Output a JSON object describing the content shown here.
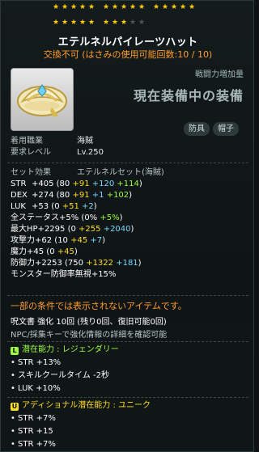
{
  "stars": {
    "total": 25,
    "filled": 23,
    "filled_color": "#ffcc00",
    "empty_color": "#555555"
  },
  "item": {
    "name": "エテルネルパイレーツハット",
    "trade_note": "交換不可 (はさみの使用可能回数:10 / 10)"
  },
  "compare": {
    "label": "戦闘力増加量",
    "current": "現在装備中の装備"
  },
  "badges": [
    "防具",
    "帽子"
  ],
  "info": [
    {
      "key": "着用職業",
      "value": "海賊"
    },
    {
      "key": "要求レベル",
      "value": "Lv.250"
    }
  ],
  "set_effect": {
    "label": "セット効果",
    "name": "エテルネルセット(海賊)"
  },
  "stats": [
    {
      "label": "STR",
      "total": "+405",
      "parts": [
        {
          "t": "(80 ",
          "c": "white"
        },
        {
          "t": "+91 ",
          "c": "yellow"
        },
        {
          "t": "+120 ",
          "c": "blue"
        },
        {
          "t": "+114",
          "c": "green"
        },
        {
          "t": ")",
          "c": "white"
        }
      ]
    },
    {
      "label": "DEX",
      "total": "+274",
      "parts": [
        {
          "t": "(80 ",
          "c": "white"
        },
        {
          "t": "+91 ",
          "c": "yellow"
        },
        {
          "t": "+1 ",
          "c": "blue"
        },
        {
          "t": "+102",
          "c": "green"
        },
        {
          "t": ")",
          "c": "white"
        }
      ]
    },
    {
      "label": "LUK",
      "total": "+53",
      "parts": [
        {
          "t": "(0 ",
          "c": "white"
        },
        {
          "t": "+51 ",
          "c": "yellow"
        },
        {
          "t": "+2",
          "c": "blue"
        },
        {
          "t": ")",
          "c": "white"
        }
      ]
    },
    {
      "label": "全ステータス",
      "total": "+5%",
      "parts": [
        {
          "t": "(0% ",
          "c": "white"
        },
        {
          "t": "+5%",
          "c": "green"
        },
        {
          "t": ")",
          "c": "white"
        }
      ]
    },
    {
      "label": "最大HP",
      "total": "+2295",
      "parts": [
        {
          "t": "(0 ",
          "c": "white"
        },
        {
          "t": "+255 ",
          "c": "yellow"
        },
        {
          "t": "+2040",
          "c": "blue"
        },
        {
          "t": ")",
          "c": "white"
        }
      ]
    },
    {
      "label": "攻撃力",
      "total": "+62",
      "parts": [
        {
          "t": "(10 ",
          "c": "white"
        },
        {
          "t": "+45 ",
          "c": "yellow"
        },
        {
          "t": "+7",
          "c": "blue"
        },
        {
          "t": ")",
          "c": "white"
        }
      ]
    },
    {
      "label": "魔力",
      "total": "+45",
      "parts": [
        {
          "t": "(0 ",
          "c": "white"
        },
        {
          "t": "+45",
          "c": "yellow"
        },
        {
          "t": ")",
          "c": "white"
        }
      ]
    },
    {
      "label": "防御力",
      "total": "+2253",
      "parts": [
        {
          "t": "(750 ",
          "c": "white"
        },
        {
          "t": "+1322 ",
          "c": "yellow"
        },
        {
          "t": "+181",
          "c": "blue"
        },
        {
          "t": ")",
          "c": "white"
        }
      ]
    },
    {
      "label": "モンスター防御率無視",
      "total": "+15%",
      "parts": []
    }
  ],
  "notice": "一部の条件では表示されないアイテムです。",
  "scroll_line": "呪文書 強化 10回 (残り0回、復旧可能0回)",
  "npc_line": "NPC/採集キーで強化情報の詳細を確認可能",
  "potential": {
    "tag": "L",
    "tag_color": "#9dfc42",
    "header": "潜在能力 : レジェンダリー",
    "lines": [
      "STR +13%",
      "スキルクールタイム -2秒",
      "LUK +10%"
    ]
  },
  "additional": {
    "tag": "U",
    "tag_color": "#ffdd22",
    "header": "アディショナル潜在能力 : ユニーク",
    "lines": [
      "STR +7%",
      "STR +15",
      "STR +7%"
    ]
  }
}
